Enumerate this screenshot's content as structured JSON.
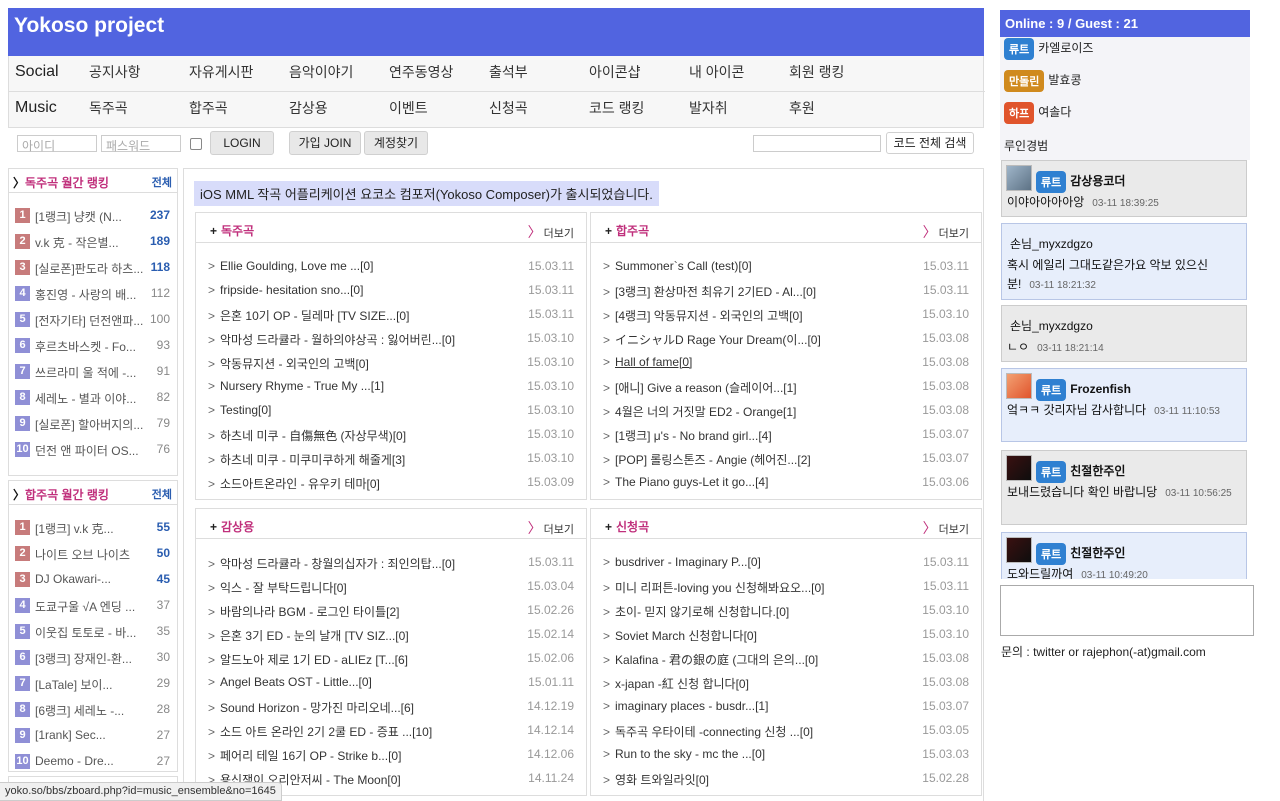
{
  "site": {
    "title": "Yokoso project"
  },
  "menu": {
    "social_label": "Social",
    "social_items": [
      "공지사항",
      "자유게시판",
      "음악이야기",
      "연주동영상",
      "출석부",
      "아이콘샵",
      "내 아이콘",
      "회원 랭킹"
    ],
    "music_label": "Music",
    "music_items": [
      "독주곡",
      "합주곡",
      "감상용",
      "이벤트",
      "신청곡",
      "코드 랭킹",
      "발자취",
      "후원"
    ]
  },
  "login": {
    "id_placeholder": "아이디",
    "pw_placeholder": "패스워드",
    "login_button": "LOGIN",
    "join_button": "가입 JOIN",
    "find_button": "계정찾기",
    "code_search_button": "코드 전체 검색"
  },
  "ranking_solo": {
    "title": "독주곡 월간 랭킹",
    "caret": "〉",
    "all_label": "전체",
    "items": [
      {
        "n": "1",
        "title": "[1랭크] 냥캣 (N...",
        "count": "237",
        "hi": true
      },
      {
        "n": "2",
        "title": "v.k 克 - 작은별...",
        "count": "189",
        "hi": true
      },
      {
        "n": "3",
        "title": "[실로폰]판도라 하츠...",
        "count": "118",
        "hi": true
      },
      {
        "n": "4",
        "title": "홍진영 - 사랑의 배...",
        "count": "112",
        "hi": false
      },
      {
        "n": "5",
        "title": "[전자기타] 던전앤파...",
        "count": "100",
        "hi": false
      },
      {
        "n": "6",
        "title": "후르츠바스켓 - Fo...",
        "count": "93",
        "hi": false
      },
      {
        "n": "7",
        "title": "쓰르라미 울 적에 -...",
        "count": "91",
        "hi": false
      },
      {
        "n": "8",
        "title": "세레노 - 별과 이야...",
        "count": "82",
        "hi": false
      },
      {
        "n": "9",
        "title": "[실로폰] 할아버지의...",
        "count": "79",
        "hi": false
      },
      {
        "n": "10",
        "title": "던전 앤 파이터 OS...",
        "count": "76",
        "hi": false
      }
    ]
  },
  "ranking_ensemble": {
    "title": "합주곡 월간 랭킹",
    "caret": "〉",
    "all_label": "전체",
    "items": [
      {
        "n": "1",
        "title": "[1랭크] v.k 克...",
        "count": "55",
        "hi": true
      },
      {
        "n": "2",
        "title": "나이트 오브 나이츠",
        "count": "50",
        "hi": true
      },
      {
        "n": "3",
        "title": "DJ Okawari-...",
        "count": "45",
        "hi": true
      },
      {
        "n": "4",
        "title": "도쿄구울 √A 엔딩 ...",
        "count": "37",
        "hi": false
      },
      {
        "n": "5",
        "title": "이웃집 토토로 - 바...",
        "count": "35",
        "hi": false
      },
      {
        "n": "6",
        "title": "[3랭크] 장재인-환...",
        "count": "30",
        "hi": false
      },
      {
        "n": "7",
        "title": "[LaTale] 보이...",
        "count": "29",
        "hi": false
      },
      {
        "n": "8",
        "title": "[6랭크] 세레노 -...",
        "count": "28",
        "hi": false
      },
      {
        "n": "9",
        "title": "[1rank] Sec...",
        "count": "27",
        "hi": false
      },
      {
        "n": "10",
        "title": "Deemo - Dre...",
        "count": "27",
        "hi": false
      }
    ]
  },
  "notice": "iOS MML 작곡 어플리케이션 요코소 컴포저(Yokoso Composer)가 출시되었습니다.",
  "boards": [
    {
      "title": "독주곡",
      "more": "더보기",
      "posts": [
        {
          "t": "Ellie Goulding, Love me ...[0]",
          "d": "15.03.11"
        },
        {
          "t": "fripside- hesitation sno...[0]",
          "d": "15.03.11"
        },
        {
          "t": "은혼 10기 OP - 딜레마 [TV SIZE...[0]",
          "d": "15.03.11"
        },
        {
          "t": "악마성 드라큘라 - 월하의야상곡 : 잃어버린...[0]",
          "d": "15.03.10"
        },
        {
          "t": "악동뮤지션 - 외국인의 고백[0]",
          "d": "15.03.10"
        },
        {
          "t": "Nursery Rhyme - True My ...[1]",
          "d": "15.03.10"
        },
        {
          "t": "Testing[0]",
          "d": "15.03.10"
        },
        {
          "t": "하츠네 미쿠 - 自傷無色 (자상무색)[0]",
          "d": "15.03.10"
        },
        {
          "t": "하츠네 미쿠 - 미쿠미쿠하게 해줄게[3]",
          "d": "15.03.10"
        },
        {
          "t": "소드아트온라인 - 유우키 테마[0]",
          "d": "15.03.09"
        }
      ]
    },
    {
      "title": "합주곡",
      "more": "더보기",
      "posts": [
        {
          "t": "Summoner`s Call (test)[0]",
          "d": "15.03.11"
        },
        {
          "t": "[3랭크] 환상마전 최유기 2기ED - Al...[0]",
          "d": "15.03.11"
        },
        {
          "t": "[4랭크] 악동뮤지션 - 외국인의 고백[0]",
          "d": "15.03.10"
        },
        {
          "t": "イニシャルD Rage Your Dream(이...[0]",
          "d": "15.03.08"
        },
        {
          "t": "Hall of fame[0]",
          "d": "15.03.08",
          "ul": true
        },
        {
          "t": "[애니] Give a reason (슬레이어...[1]",
          "d": "15.03.08"
        },
        {
          "t": "4월은 너의 거짓말 ED2 - Orange[1]",
          "d": "15.03.08"
        },
        {
          "t": "[1랭크] μ's - No brand girl...[4]",
          "d": "15.03.07"
        },
        {
          "t": "[POP] 롤링스톤즈 - Angie (헤어진...[2]",
          "d": "15.03.07"
        },
        {
          "t": "The Piano guys-Let it go...[4]",
          "d": "15.03.06"
        }
      ]
    },
    {
      "title": "감상용",
      "more": "더보기",
      "posts": [
        {
          "t": "악마성 드라큘라 - 창월의십자가 : 죄인의탑...[0]",
          "d": "15.03.11"
        },
        {
          "t": "익스 - 잘 부탁드립니다[0]",
          "d": "15.03.04"
        },
        {
          "t": "바람의나라 BGM - 로그인 타이틀[2]",
          "d": "15.02.26"
        },
        {
          "t": "은혼 3기 ED - 눈의 날개 [TV SIZ...[0]",
          "d": "15.02.14"
        },
        {
          "t": "알드노아 제로 1기 ED - aLIEz [T...[6]",
          "d": "15.02.06"
        },
        {
          "t": "Angel Beats OST - Little...[0]",
          "d": "15.01.11"
        },
        {
          "t": "Sound Horizon - 망가진 마리오네...[6]",
          "d": "14.12.19"
        },
        {
          "t": "소드 아트 온라인 2기 2쿨 ED - 증표 ...[10]",
          "d": "14.12.14"
        },
        {
          "t": "페어리 테일 16기 OP - Strike b...[0]",
          "d": "14.12.06"
        },
        {
          "t": "용신잭이 오리안저씨 - The Moon[0]",
          "d": "14.11.24"
        }
      ]
    },
    {
      "title": "신청곡",
      "more": "더보기",
      "posts": [
        {
          "t": "busdriver - Imaginary P...[0]",
          "d": "15.03.11"
        },
        {
          "t": "미니 리퍼튼-loving you 신청해봐요오...[0]",
          "d": "15.03.11"
        },
        {
          "t": "초이- 믿지 않기로해 신청합니다.[0]",
          "d": "15.03.10"
        },
        {
          "t": "Soviet March 신청합니다[0]",
          "d": "15.03.10"
        },
        {
          "t": "Kalafina - 君の銀の庭 (그대의 은의...[0]",
          "d": "15.03.08"
        },
        {
          "t": "x-japan -紅 신청 합니다[0]",
          "d": "15.03.08"
        },
        {
          "t": "imaginary places - busdr...[1]",
          "d": "15.03.07"
        },
        {
          "t": "독주곡 우타이테 -connecting 신청 ...[0]",
          "d": "15.03.05"
        },
        {
          "t": "Run to the sky - mc the ...[0]",
          "d": "15.03.03"
        },
        {
          "t": "영화 트와일라잇[0]",
          "d": "15.02.28"
        }
      ]
    }
  ],
  "online": {
    "header": "Online : 9 / Guest : 21",
    "users": [
      {
        "badge": "류트",
        "name": "카엘로이즈",
        "color": "#2f80d1"
      },
      {
        "badge": "만돌린",
        "name": "발효콩",
        "color": "#d08a1e"
      },
      {
        "badge": "하프",
        "name": "여솔다",
        "color": "#e0542c"
      }
    ],
    "plain_user": "루인경범"
  },
  "chat": [
    {
      "badge": "류트",
      "nick": "감상용코더",
      "msg": "이야아아아아앙",
      "time": "03-11 18:39:25"
    },
    {
      "badge": "",
      "nick": "손님_myxzdgzo",
      "msg": "혹시 에일리 그대도같은가요 악보 있으신분!",
      "time": "03-11 18:21:32"
    },
    {
      "badge": "",
      "nick": "손님_myxzdgzo",
      "msg": "ㄴㅇ",
      "time": "03-11 18:21:14"
    },
    {
      "badge": "류트",
      "nick": "Frozenfish",
      "msg": "엌ㅋㅋ 갓리자님 감사합니다",
      "time": "03-11 11:10:53"
    },
    {
      "badge": "류트",
      "nick": "친절한주인",
      "msg": "보내드렸습니다 확인 바랍니당",
      "time": "03-11 10:56:25"
    },
    {
      "badge": "류트",
      "nick": "친절한주인",
      "msg": "도와드릴까여",
      "time": "03-11 10:49:20"
    }
  ],
  "contact": "문의 : twitter or rajephon(-at)gmail.com",
  "status_url": "yoko.so/bbs/zboard.php?id=music_ensemble&no=1645",
  "colors": {
    "accent": "#5164e0",
    "pink": "#c0307c",
    "rank_top": "#c77b7b",
    "rank_other": "#8f8fd6"
  }
}
